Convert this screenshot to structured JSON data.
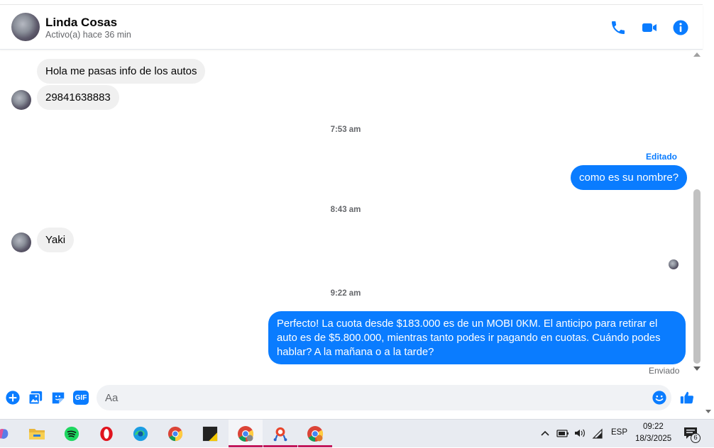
{
  "header": {
    "name": "Linda Cosas",
    "status": "Activo(a) hace 36 min"
  },
  "messages": {
    "m1": "Hola me pasas info de los autos",
    "m2": "29841638883",
    "ts1": "7:53 am",
    "edited": "Editado",
    "m3": "como es su nombre?",
    "ts2": "8:43 am",
    "m4": "Yaki",
    "ts3": "9:22 am",
    "m5_l1": "Perfecto! La cuota desde $183.000 es de un MOBI 0KM. El anticipo para retirar el",
    "m5_l2": "auto es de $5.800.000, mientras tanto podes ir pagando en cuotas. Cuándo podes",
    "m5_l3": "hablar? A la mañana o a la tarde?",
    "sent": "Enviado"
  },
  "composer": {
    "placeholder": "Aa",
    "gif_label": "GIF"
  },
  "taskbar": {
    "lang": "ESP",
    "time": "09:22",
    "date": "18/3/2025",
    "notif_count": "6"
  },
  "colors": {
    "accent": "#0a7cff",
    "bubble_in": "#f0f0f0",
    "taskbar_bg": "#e8ebf1"
  }
}
